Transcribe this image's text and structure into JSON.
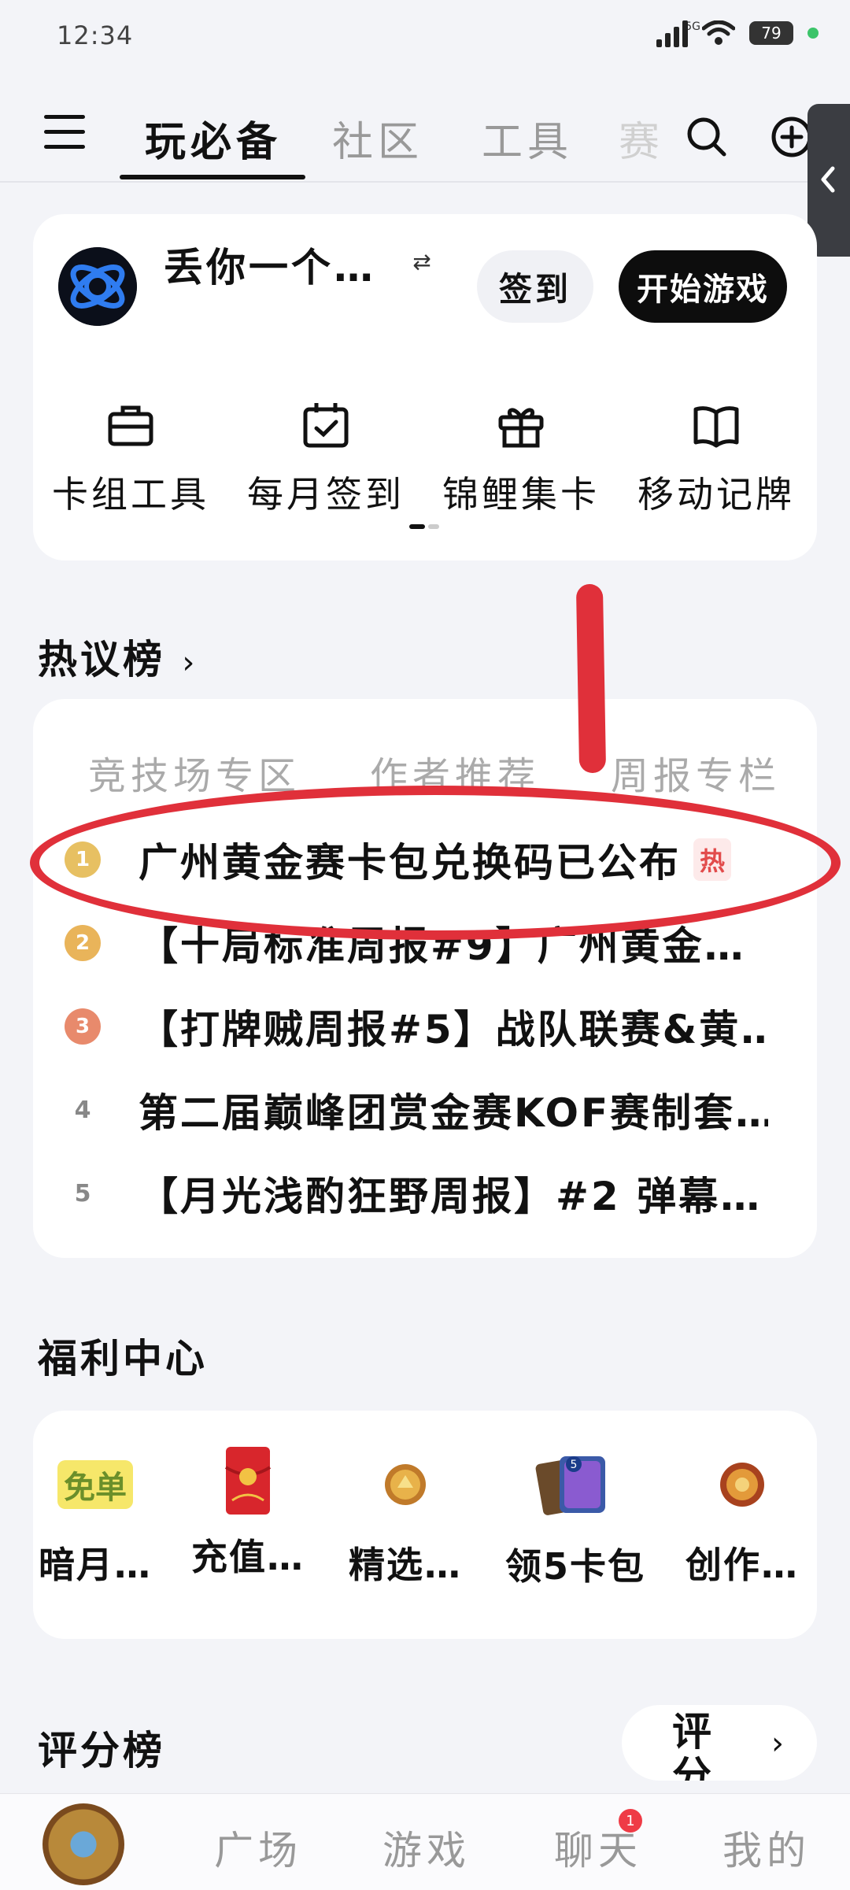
{
  "status_bar": {
    "time": "12:34",
    "network": "5G",
    "battery": "79"
  },
  "top_nav": {
    "tabs": [
      {
        "label": "玩必备",
        "active": true
      },
      {
        "label": "社区",
        "active": false
      },
      {
        "label": "工具",
        "active": false
      },
      {
        "label": "赛",
        "active": false
      }
    ]
  },
  "profile": {
    "username": "丢你一个…",
    "signin_label": "签到",
    "start_label": "开始游戏"
  },
  "tools": [
    {
      "label": "卡组工具",
      "icon": "briefcase-icon"
    },
    {
      "label": "每月签到",
      "icon": "calendar-check-icon"
    },
    {
      "label": "锦鲤集卡",
      "icon": "gift-icon"
    },
    {
      "label": "移动记牌",
      "icon": "book-icon"
    }
  ],
  "hot": {
    "title": "热议榜",
    "tabs": [
      "竞技场专区",
      "作者推荐",
      "周报专栏"
    ],
    "items": [
      {
        "rank": "1",
        "text": "广州黄金赛卡包兑换码已公布",
        "badge": "热"
      },
      {
        "rank": "2",
        "text": "【十局标准周报#9】广州黄金…"
      },
      {
        "rank": "3",
        "text": "【打牌贼周报#5】战队联赛&黄…"
      },
      {
        "rank": "4",
        "text": "第二届巅峰团赏金赛KOF赛制套…"
      },
      {
        "rank": "5",
        "text": "【月光浅酌狂野周报】#2 弹幕…"
      }
    ]
  },
  "welfare": {
    "title": "福利中心",
    "items": [
      {
        "label": "暗月…",
        "icon": "free-order-icon",
        "icon_text": "免单"
      },
      {
        "label": "充值…",
        "icon": "red-packet-icon"
      },
      {
        "label": "精选…",
        "icon": "coin-icon"
      },
      {
        "label": "领5卡包",
        "icon": "card-pack-icon",
        "icon_text": "5"
      },
      {
        "label": "创作…",
        "icon": "medal-icon"
      }
    ]
  },
  "rating": {
    "title": "评分榜",
    "button_label": "评分广场"
  },
  "bottom_nav": {
    "items": [
      "广场",
      "游戏",
      "聊天",
      "我的"
    ],
    "chat_badge": "1"
  },
  "colors": {
    "annotation": "#e0303a",
    "rank1": "#e7c062",
    "rank2": "#e9b45a",
    "rank3": "#e88a6c"
  }
}
